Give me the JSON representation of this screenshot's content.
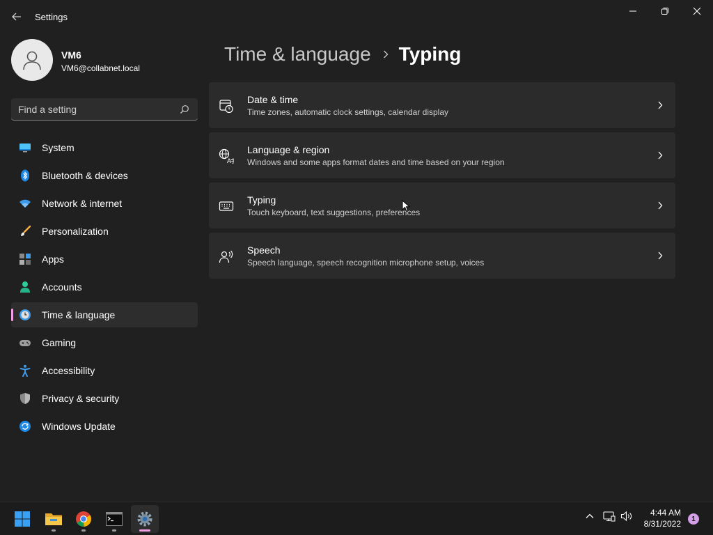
{
  "app": {
    "title": "Settings"
  },
  "profile": {
    "name": "VM6",
    "email": "VM6@collabnet.local"
  },
  "search": {
    "placeholder": "Find a setting"
  },
  "sidebar": {
    "items": [
      {
        "label": "System",
        "icon": "monitor-icon"
      },
      {
        "label": "Bluetooth & devices",
        "icon": "bluetooth-icon"
      },
      {
        "label": "Network & internet",
        "icon": "wifi-icon"
      },
      {
        "label": "Personalization",
        "icon": "brush-icon"
      },
      {
        "label": "Apps",
        "icon": "apps-icon"
      },
      {
        "label": "Accounts",
        "icon": "person-icon"
      },
      {
        "label": "Time & language",
        "icon": "globe-clock-icon",
        "active": true
      },
      {
        "label": "Gaming",
        "icon": "gamepad-icon"
      },
      {
        "label": "Accessibility",
        "icon": "accessibility-icon"
      },
      {
        "label": "Privacy & security",
        "icon": "shield-icon"
      },
      {
        "label": "Windows Update",
        "icon": "update-icon"
      }
    ]
  },
  "breadcrumb": {
    "parent": "Time & language",
    "current": "Typing"
  },
  "cards": [
    {
      "title": "Date & time",
      "description": "Time zones, automatic clock settings, calendar display",
      "icon": "calendar-clock-icon"
    },
    {
      "title": "Language & region",
      "description": "Windows and some apps format dates and time based on your region",
      "icon": "language-icon"
    },
    {
      "title": "Typing",
      "description": "Touch keyboard, text suggestions, preferences",
      "icon": "keyboard-icon"
    },
    {
      "title": "Speech",
      "description": "Speech language, speech recognition microphone setup, voices",
      "icon": "speech-icon"
    }
  ],
  "taskbar": {
    "apps": [
      "start-icon",
      "file-explorer-icon",
      "chrome-icon",
      "terminal-icon",
      "settings-icon"
    ],
    "clock": {
      "time": "4:44 AM",
      "date": "8/31/2022"
    },
    "notification_count": "1"
  },
  "colors": {
    "background": "#202020",
    "card": "#2b2b2b",
    "accent": "#f29ee6"
  }
}
